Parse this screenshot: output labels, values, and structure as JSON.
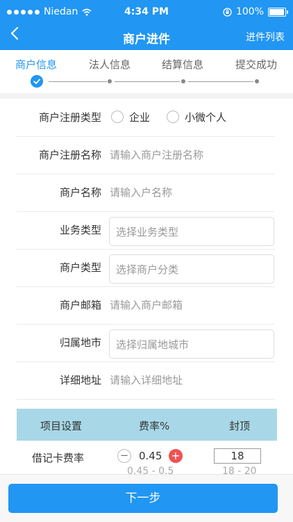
{
  "status_bar": {
    "carrier": "Niedan",
    "time": "4:34 PM",
    "battery": "100%"
  },
  "navbar": {
    "title": "商户进件",
    "right_link": "进件列表"
  },
  "steps": [
    {
      "label": "商户信息",
      "active": true
    },
    {
      "label": "法人信息",
      "active": false
    },
    {
      "label": "结算信息",
      "active": false
    },
    {
      "label": "提交成功",
      "active": false
    }
  ],
  "form": {
    "reg_type": {
      "label": "商户注册类型",
      "options": [
        "企业",
        "小微个人"
      ]
    },
    "reg_name": {
      "label": "商户注册名称",
      "placeholder": "请输入商户注册名称"
    },
    "merchant_name": {
      "label": "商户名称",
      "placeholder": "请输入户名称"
    },
    "business_type": {
      "label": "业务类型",
      "placeholder": "选择业务类型"
    },
    "merchant_type": {
      "label": "商户类型",
      "placeholder": "选择商户分类"
    },
    "email": {
      "label": "商户邮箱",
      "placeholder": "请输入商户邮箱"
    },
    "city": {
      "label": "归属地市",
      "placeholder": "选择归属地城市"
    },
    "address": {
      "label": "详细地址",
      "placeholder": "请输入详细地址"
    }
  },
  "rate_table": {
    "headers": [
      "项目设置",
      "费率%",
      "封顶"
    ],
    "rows": [
      {
        "item": "借记卡费率",
        "rate": "0.45",
        "rate_range": "0.45 - 0.5",
        "cap": "18",
        "cap_range": "18 - 20"
      }
    ]
  },
  "footer": {
    "next_label": "下一步"
  }
}
